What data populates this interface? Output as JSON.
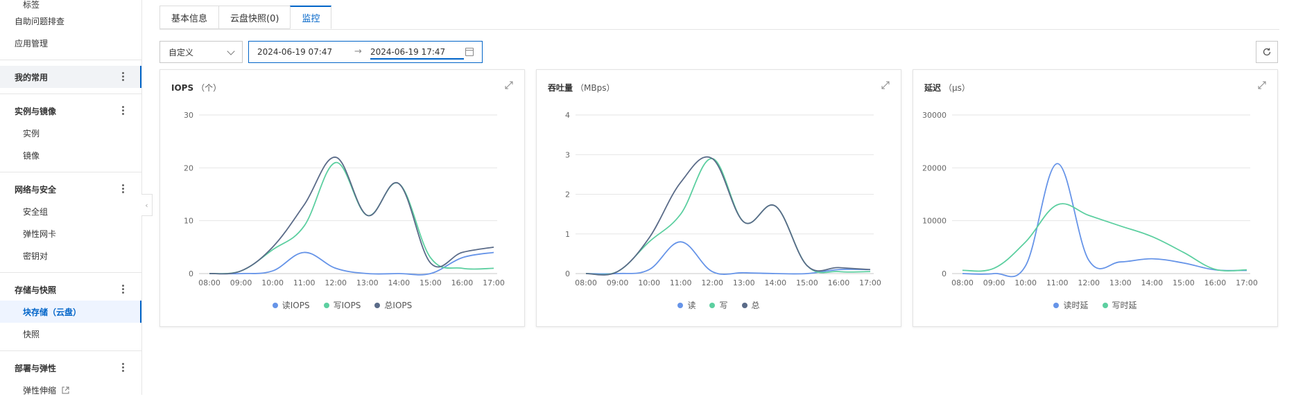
{
  "sidebar": {
    "items": [
      {
        "label": "标签",
        "type": "sub-top",
        "y": -10
      },
      {
        "label": "自助问题排查",
        "type": "plain",
        "y": 14
      },
      {
        "label": "应用管理",
        "type": "plain",
        "y": 46
      },
      {
        "label": "我的常用",
        "type": "group-active",
        "y": 95
      },
      {
        "label": "实例与镜像",
        "type": "group",
        "y": 144
      },
      {
        "label": "实例",
        "type": "sub",
        "y": 176
      },
      {
        "label": "镜像",
        "type": "sub",
        "y": 208
      },
      {
        "label": "网络与安全",
        "type": "group",
        "y": 257
      },
      {
        "label": "安全组",
        "type": "sub",
        "y": 289
      },
      {
        "label": "弹性网卡",
        "type": "sub",
        "y": 321
      },
      {
        "label": "密钥对",
        "type": "sub",
        "y": 353
      },
      {
        "label": "存储与快照",
        "type": "group",
        "y": 402
      },
      {
        "label": "块存储（云盘）",
        "type": "selected",
        "y": 434
      },
      {
        "label": "快照",
        "type": "sub",
        "y": 466
      },
      {
        "label": "部署与弹性",
        "type": "group",
        "y": 515
      },
      {
        "label": "弹性伸缩",
        "type": "sub-ext",
        "y": 547
      }
    ]
  },
  "tabs": [
    {
      "label": "基本信息",
      "active": false
    },
    {
      "label": "云盘快照(0)",
      "active": false
    },
    {
      "label": "监控",
      "active": true
    }
  ],
  "toolbar": {
    "select_value": "自定义",
    "range_start": "2024-06-19 07:47",
    "range_end": "2024-06-19 17:47",
    "range_arrow": "→"
  },
  "colors": {
    "read": "#6694e8",
    "write": "#5ccfa0",
    "total": "#5a6b88",
    "grid": "#e6e6e6",
    "accent": "#0064c8"
  },
  "chart_data": [
    {
      "type": "line",
      "title": "IOPS",
      "unit": "（个）",
      "x": [
        "08:00",
        "09:00",
        "10:00",
        "11:00",
        "12:00",
        "13:00",
        "14:00",
        "15:00",
        "16:00",
        "17:00"
      ],
      "ylim": [
        0,
        30
      ],
      "yticks": [
        0,
        10,
        20,
        30
      ],
      "series": [
        {
          "name": "读IOPS",
          "key": "read",
          "points": [
            [
              0,
              0
            ],
            [
              1,
              0
            ],
            [
              2,
              0.5
            ],
            [
              3,
              4
            ],
            [
              4,
              1
            ],
            [
              5,
              0
            ],
            [
              6,
              0
            ],
            [
              7,
              0
            ],
            [
              8,
              3
            ],
            [
              9,
              4
            ]
          ]
        },
        {
          "name": "写IOPS",
          "key": "write",
          "points": [
            [
              0,
              0
            ],
            [
              1,
              0.5
            ],
            [
              2,
              4.5
            ],
            [
              3,
              9
            ],
            [
              4,
              21
            ],
            [
              5,
              11
            ],
            [
              6,
              17
            ],
            [
              7,
              3
            ],
            [
              8,
              1
            ],
            [
              9,
              1
            ]
          ]
        },
        {
          "name": "总IOPS",
          "key": "total",
          "points": [
            [
              0,
              0
            ],
            [
              1,
              0.5
            ],
            [
              2,
              5
            ],
            [
              3,
              13
            ],
            [
              4,
              22
            ],
            [
              5,
              11
            ],
            [
              6,
              17
            ],
            [
              7,
              2
            ],
            [
              8,
              4
            ],
            [
              9,
              5
            ]
          ]
        }
      ]
    },
    {
      "type": "line",
      "title": "吞吐量",
      "unit": "（MBps）",
      "x": [
        "08:00",
        "09:00",
        "10:00",
        "11:00",
        "12:00",
        "13:00",
        "14:00",
        "15:00",
        "16:00",
        "17:00"
      ],
      "ylim": [
        0,
        4
      ],
      "yticks": [
        0,
        1,
        2,
        3,
        4
      ],
      "series": [
        {
          "name": "读",
          "key": "read",
          "points": [
            [
              0,
              0
            ],
            [
              1,
              0
            ],
            [
              2,
              0.1
            ],
            [
              3,
              0.8
            ],
            [
              4,
              0.05
            ],
            [
              5,
              0.02
            ],
            [
              6,
              0
            ],
            [
              7,
              0
            ],
            [
              8,
              0.1
            ],
            [
              9,
              0.1
            ]
          ]
        },
        {
          "name": "写",
          "key": "write",
          "points": [
            [
              0,
              0
            ],
            [
              1,
              0.05
            ],
            [
              2,
              0.8
            ],
            [
              3,
              1.5
            ],
            [
              4,
              2.9
            ],
            [
              5,
              1.3
            ],
            [
              6,
              1.7
            ],
            [
              7,
              0.2
            ],
            [
              8,
              0.05
            ],
            [
              9,
              0.05
            ]
          ]
        },
        {
          "name": "总",
          "key": "total",
          "points": [
            [
              0,
              0
            ],
            [
              1,
              0.05
            ],
            [
              2,
              0.9
            ],
            [
              3,
              2.3
            ],
            [
              4,
              2.9
            ],
            [
              5,
              1.3
            ],
            [
              6,
              1.7
            ],
            [
              7,
              0.2
            ],
            [
              8,
              0.15
            ],
            [
              9,
              0.1
            ]
          ]
        }
      ]
    },
    {
      "type": "line",
      "title": "延迟",
      "unit": "（μs）",
      "x": [
        "08:00",
        "09:00",
        "10:00",
        "11:00",
        "12:00",
        "13:00",
        "14:00",
        "15:00",
        "16:00",
        "17:00"
      ],
      "ylim": [
        0,
        30000
      ],
      "yticks": [
        0,
        10000,
        20000,
        30000
      ],
      "series": [
        {
          "name": "读时延",
          "key": "read",
          "points": [
            [
              0,
              0
            ],
            [
              1,
              0
            ],
            [
              2,
              1500
            ],
            [
              3,
              20800
            ],
            [
              4,
              2500
            ],
            [
              5,
              2200
            ],
            [
              6,
              2800
            ],
            [
              7,
              2000
            ],
            [
              8,
              700
            ],
            [
              9,
              600
            ]
          ]
        },
        {
          "name": "写时延",
          "key": "write",
          "points": [
            [
              0,
              600
            ],
            [
              1,
              1000
            ],
            [
              2,
              6000
            ],
            [
              3,
              13000
            ],
            [
              4,
              11000
            ],
            [
              5,
              9000
            ],
            [
              6,
              7000
            ],
            [
              7,
              4000
            ],
            [
              8,
              800
            ],
            [
              9,
              700
            ]
          ]
        }
      ]
    }
  ]
}
